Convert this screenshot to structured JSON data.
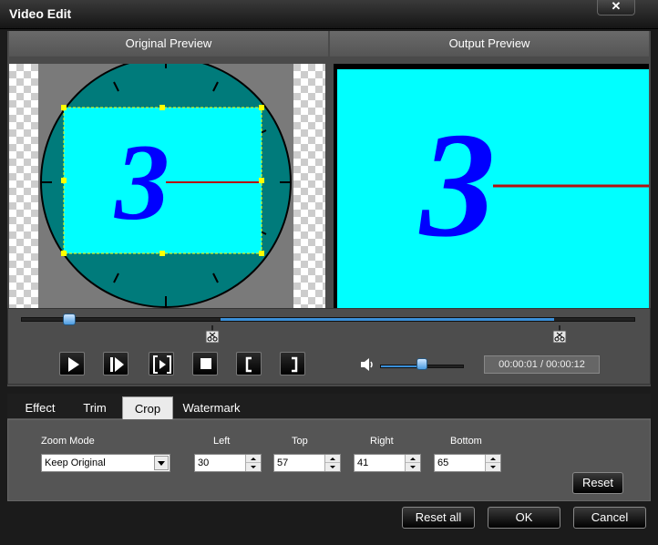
{
  "window": {
    "title": "Video Edit",
    "close_label": "✕"
  },
  "preview": {
    "original_label": "Original Preview",
    "output_label": "Output Preview",
    "countdown_digit": "3"
  },
  "timeline": {
    "time_readout": "00:00:01 / 00:00:12"
  },
  "tabs": [
    {
      "label": "Effect"
    },
    {
      "label": "Trim"
    },
    {
      "label": "Crop"
    },
    {
      "label": "Watermark"
    }
  ],
  "crop": {
    "zoom_mode_label": "Zoom Mode",
    "zoom_mode_value": "Keep Original",
    "left_label": "Left",
    "left_value": "30",
    "top_label": "Top",
    "top_value": "57",
    "right_label": "Right",
    "right_value": "41",
    "bottom_label": "Bottom",
    "bottom_value": "65",
    "reset_label": "Reset"
  },
  "footer": {
    "reset_all_label": "Reset all",
    "ok_label": "OK",
    "cancel_label": "Cancel"
  },
  "colors": {
    "accent": "#3a8fd8",
    "clock_face": "#007b7b",
    "frame_fill": "#00ffff",
    "digit": "#0000ff",
    "hand": "#b31010"
  }
}
